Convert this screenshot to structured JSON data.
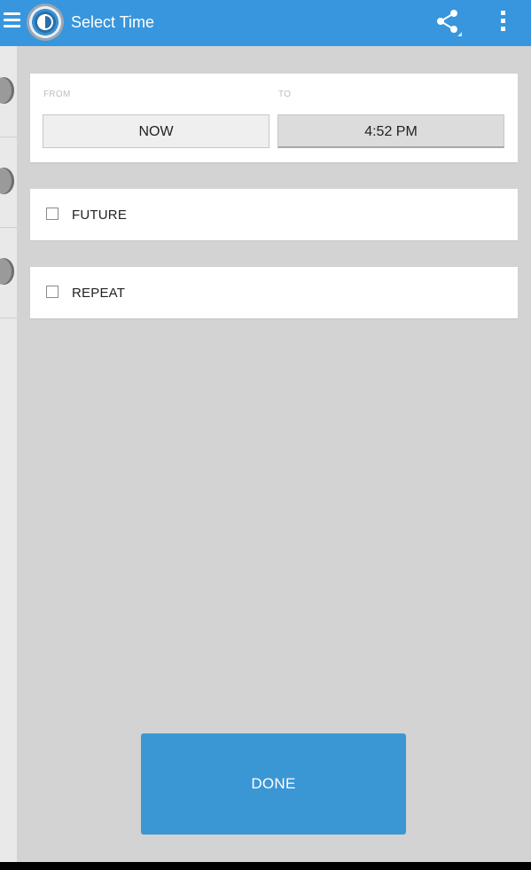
{
  "appbar": {
    "title": "Select Time",
    "icons": [
      "menu-icon",
      "app-logo",
      "share-icon",
      "overflow-menu-icon"
    ],
    "color": "#3796dd"
  },
  "range": {
    "from_label": "FROM",
    "to_label": "TO",
    "from_value": "NOW",
    "to_value": "4:52 PM"
  },
  "options": {
    "future": {
      "label": "FUTURE",
      "checked": false
    },
    "repeat": {
      "label": "REPEAT",
      "checked": false
    }
  },
  "done_label": "DONE",
  "colors": {
    "accent": "#3b96d4",
    "background": "#d3d3d3",
    "card": "#ffffff"
  }
}
